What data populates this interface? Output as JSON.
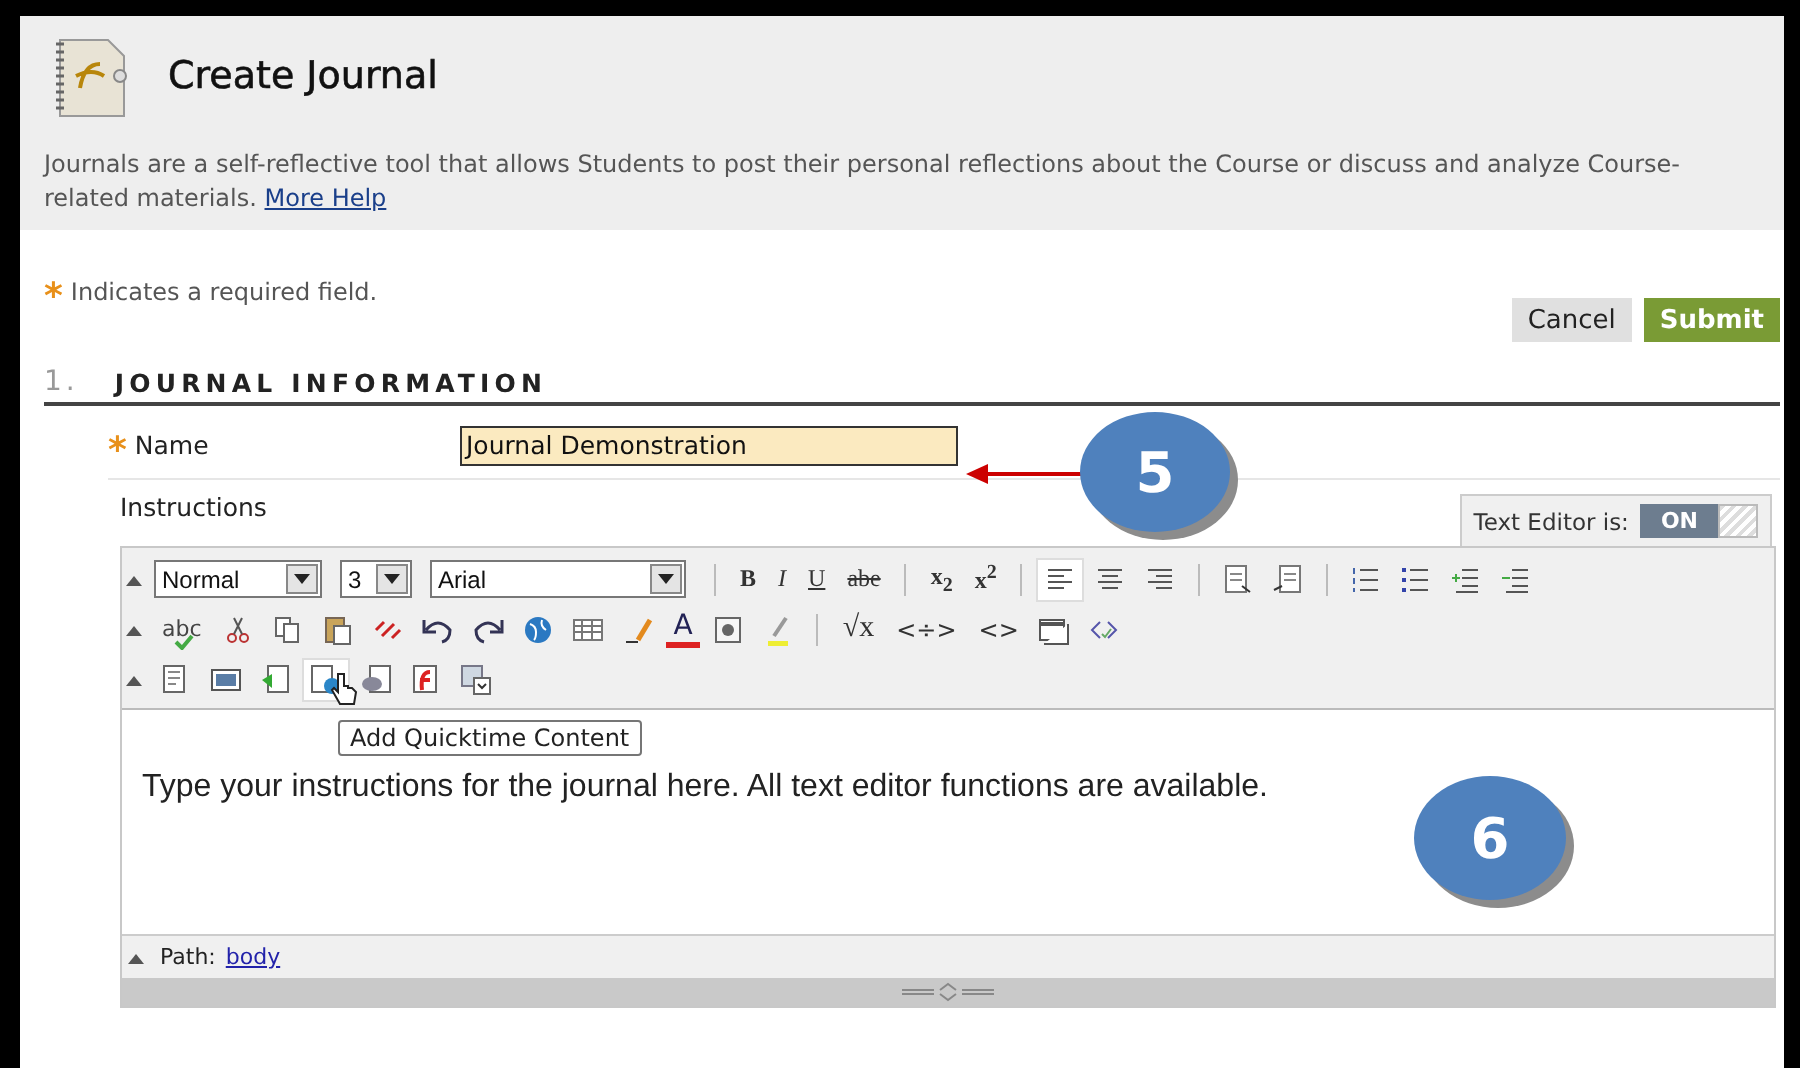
{
  "header": {
    "title": "Create Journal",
    "description": "Journals are a self-reflective tool that allows Students to post their personal reflections about the Course or discuss and analyze Course-related materials.",
    "help_link": "More Help"
  },
  "required_note": {
    "mark": "*",
    "text": "Indicates a required field."
  },
  "buttons": [
    {
      "label": "Cancel",
      "kind": "secondary"
    },
    {
      "label": "Submit",
      "kind": "primary"
    }
  ],
  "section": {
    "number": "1.",
    "title": "JOURNAL INFORMATION"
  },
  "name_field": {
    "mark": "*",
    "label": "Name",
    "value": "Journal Demonstration",
    "highlighted": true
  },
  "instructions": {
    "label": "Instructions"
  },
  "text_editor": {
    "label": "Text Editor is:",
    "state": "ON",
    "on": true
  },
  "toolbar": {
    "lines": [
      {
        "items": [
          {
            "kind": "select",
            "value": "Normal"
          },
          {
            "kind": "select",
            "value": "3"
          },
          {
            "kind": "select",
            "value": "Arial"
          },
          {
            "kind": "separator"
          },
          {
            "kind": "glyph",
            "label": "B"
          },
          {
            "kind": "glyph",
            "label": "I"
          },
          {
            "kind": "glyph",
            "label": "U"
          },
          {
            "kind": "glyph",
            "label": "abe"
          },
          {
            "kind": "separator"
          },
          {
            "kind": "glyph",
            "label": "x$_{2}$"
          },
          {
            "kind": "glyph",
            "label": "x$^{2}$"
          },
          {
            "kind": "separator"
          },
          {
            "kind": "icon",
            "selected": true
          },
          {
            "kind": "icon",
            "selected": false
          },
          {
            "kind": "icon",
            "selected": false
          },
          {
            "kind": "separator"
          },
          {
            "kind": "icon",
            "selected": false
          },
          {
            "kind": "icon",
            "selected": false
          },
          {
            "kind": "separator"
          },
          {
            "kind": "icon",
            "selected": false
          },
          {
            "kind": "icon",
            "selected": false
          },
          {
            "kind": "icon",
            "selected": false
          },
          {
            "kind": "icon",
            "selected": false
          }
        ]
      },
      {
        "items": [
          {
            "kind": "spell",
            "label": "abc"
          },
          {
            "kind": "icon",
            "selected": false
          },
          {
            "kind": "icon",
            "selected": false
          },
          {
            "kind": "icon",
            "selected": false
          },
          {
            "kind": "icon",
            "selected": false
          },
          {
            "kind": "icon",
            "selected": false
          },
          {
            "kind": "icon",
            "selected": false
          },
          {
            "kind": "icon",
            "selected": false
          },
          {
            "kind": "icon",
            "selected": false
          },
          {
            "kind": "icon",
            "selected": false
          },
          {
            "kind": "fontcolor",
            "label": "A"
          },
          {
            "kind": "icon",
            "selected": false
          },
          {
            "kind": "icon",
            "selected": false
          },
          {
            "kind": "separator"
          },
          {
            "kind": "glyph",
            "label": "√x"
          },
          {
            "kind": "glyph",
            "label": "<÷>"
          },
          {
            "kind": "glyph",
            "label": "<>"
          },
          {
            "kind": "icon",
            "selected": false
          },
          {
            "kind": "icon",
            "selected": false
          }
        ]
      },
      {
        "items": [
          {
            "kind": "icon",
            "selected": false
          },
          {
            "kind": "icon",
            "selected": false
          },
          {
            "kind": "icon",
            "selected": false
          },
          {
            "kind": "icon",
            "selected": true
          },
          {
            "kind": "icon",
            "selected": false
          },
          {
            "kind": "icon",
            "selected": false
          },
          {
            "kind": "icon",
            "selected": false
          }
        ]
      }
    ]
  },
  "tooltip": "Add Quicktime Content",
  "editor_text": "Type your instructions for the journal here. All text editor functions are available.",
  "path_bar": {
    "label": "Path:",
    "link": "body"
  },
  "callouts": [
    {
      "number": "5",
      "kind": "arrow"
    },
    {
      "number": "6",
      "kind": "plain"
    }
  ]
}
